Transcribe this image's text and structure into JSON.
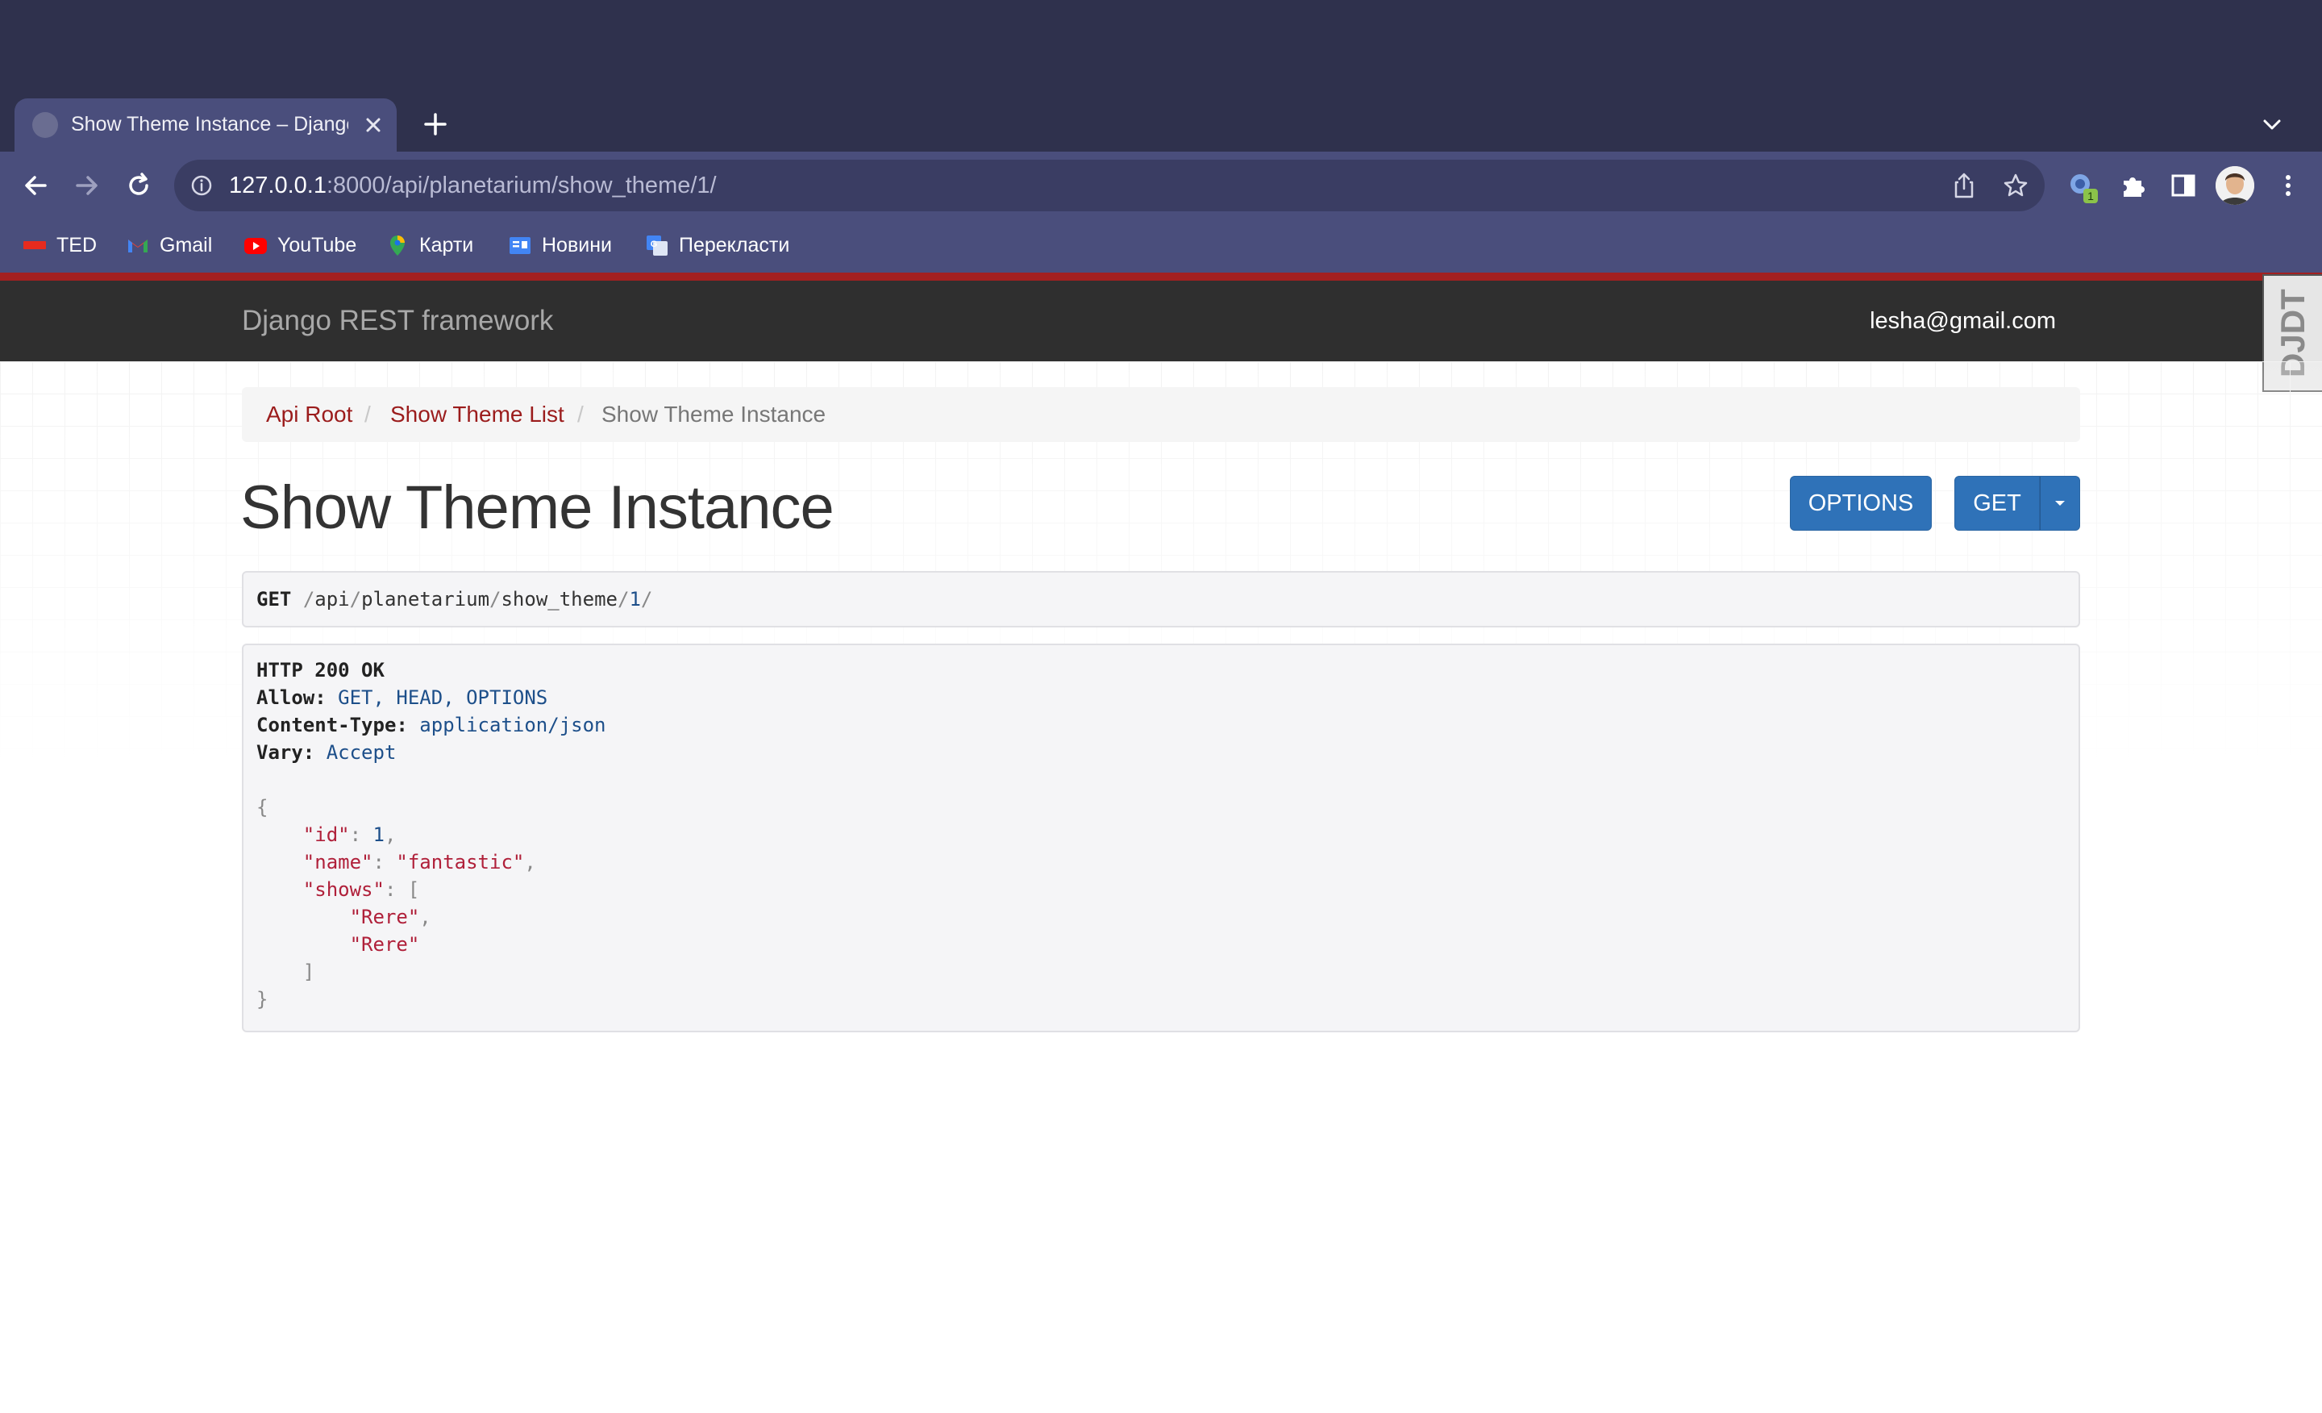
{
  "browser": {
    "tab_title": "Show Theme Instance – Django REST framework",
    "url_host": "127.0.0.1",
    "url_rest": ":8000/api/planetarium/show_theme/1/",
    "extension_badge": "1",
    "bookmarks": [
      {
        "icon": "ted-icon",
        "label": "TED"
      },
      {
        "icon": "gmail-icon",
        "label": "Gmail"
      },
      {
        "icon": "youtube-icon",
        "label": "YouTube"
      },
      {
        "icon": "maps-icon",
        "label": "Карти"
      },
      {
        "icon": "news-icon",
        "label": "Новини"
      },
      {
        "icon": "translate-icon",
        "label": "Перекласти"
      }
    ]
  },
  "navbar": {
    "brand": "Django REST framework",
    "user_email": "lesha@gmail.com",
    "debug_toolbar_label": "DJDT"
  },
  "breadcrumb": {
    "items": [
      "Api Root",
      "Show Theme List",
      "Show Theme Instance"
    ],
    "separator": "/"
  },
  "page": {
    "title": "Show Theme Instance",
    "options_button": "OPTIONS",
    "get_button": "GET"
  },
  "request": {
    "method": "GET",
    "path_segments": [
      "api",
      "planetarium",
      "show_theme",
      "1"
    ]
  },
  "response": {
    "status": "HTTP 200 OK",
    "headers": [
      {
        "name": "Allow:",
        "value": "GET, HEAD, OPTIONS"
      },
      {
        "name": "Content-Type:",
        "value": "application/json"
      },
      {
        "name": "Vary:",
        "value": "Accept"
      }
    ],
    "body": {
      "id_key": "\"id\"",
      "id_value": "1",
      "name_key": "\"name\"",
      "name_value": "\"fantastic\"",
      "shows_key": "\"shows\"",
      "shows_items": [
        "\"Rere\"",
        "\"Rere\""
      ]
    }
  },
  "colors": {
    "link": "#9b1c1c",
    "button": "#2f72b8",
    "navbar": "#2f2f2f",
    "accent_line": "#a32020"
  }
}
